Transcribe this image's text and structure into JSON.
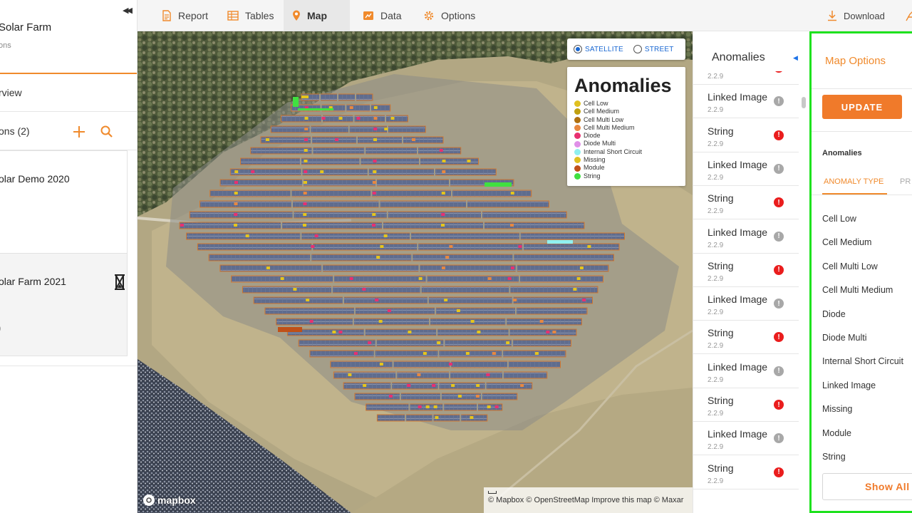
{
  "sidebar": {
    "site_title": "Solar Farm",
    "site_subtitle": "ons",
    "overview_label": "rview",
    "inspections_label": "ons (2)",
    "cards": [
      {
        "title": "olar Demo 2020",
        "meta": ""
      },
      {
        "title": "olar Farm 2021",
        "meta": ")"
      }
    ]
  },
  "toolbar": {
    "tabs": [
      {
        "label": "Report",
        "icon": "report-icon"
      },
      {
        "label": "Tables",
        "icon": "table-icon"
      },
      {
        "label": "Map",
        "icon": "map-pin-icon",
        "active": true
      },
      {
        "label": "Data",
        "icon": "data-icon"
      },
      {
        "label": "Options",
        "icon": "gear-icon"
      }
    ],
    "download_label": "Download",
    "accent": "#f08a2c"
  },
  "map": {
    "style_options": [
      "SATELLITE",
      "STREET"
    ],
    "selected_style": "SATELLITE",
    "legend_title": "Anomalies",
    "legend": [
      {
        "label": "Cell Low",
        "color": "#e0c020"
      },
      {
        "label": "Cell Medium",
        "color": "#c0a010"
      },
      {
        "label": "Cell Multi Low",
        "color": "#b07010"
      },
      {
        "label": "Cell Multi Medium",
        "color": "#e88840"
      },
      {
        "label": "Diode",
        "color": "#e83070"
      },
      {
        "label": "Diode Multi",
        "color": "#e090e8"
      },
      {
        "label": "Internal Short Circuit",
        "color": "#90f0f0"
      },
      {
        "label": "Missing",
        "color": "#e0c020"
      },
      {
        "label": "Module",
        "color": "#c05018"
      },
      {
        "label": "String",
        "color": "#40e040"
      }
    ],
    "logo_text": "mapbox",
    "attribution": "© Mapbox © OpenStreetMap Improve this map © Maxar"
  },
  "anomaly_list": {
    "title": "Anomalies",
    "items": [
      {
        "name": "",
        "version": "2.2.9",
        "kind": "err"
      },
      {
        "name": "Linked Image",
        "version": "2.2.9",
        "kind": "info"
      },
      {
        "name": "String",
        "version": "2.2.9",
        "kind": "err"
      },
      {
        "name": "Linked Image",
        "version": "2.2.9",
        "kind": "info"
      },
      {
        "name": "String",
        "version": "2.2.9",
        "kind": "err"
      },
      {
        "name": "Linked Image",
        "version": "2.2.9",
        "kind": "info"
      },
      {
        "name": "String",
        "version": "2.2.9",
        "kind": "err"
      },
      {
        "name": "Linked Image",
        "version": "2.2.9",
        "kind": "info"
      },
      {
        "name": "String",
        "version": "2.2.9",
        "kind": "err"
      },
      {
        "name": "Linked Image",
        "version": "2.2.9",
        "kind": "info"
      },
      {
        "name": "String",
        "version": "2.2.9",
        "kind": "err"
      },
      {
        "name": "Linked Image",
        "version": "2.2.9",
        "kind": "info"
      },
      {
        "name": "String",
        "version": "2.2.9",
        "kind": "err"
      }
    ]
  },
  "map_options": {
    "title": "Map Options",
    "update_label": "UPDATE",
    "section_label": "Anomalies",
    "tab_type": "ANOMALY TYPE",
    "tab_priority": "PR",
    "types": [
      "Cell Low",
      "Cell Medium",
      "Cell Multi Low",
      "Cell Multi Medium",
      "Diode",
      "Diode Multi",
      "Internal Short Circuit",
      "Linked Image",
      "Missing",
      "Module",
      "String"
    ],
    "show_all_label": "Show All"
  }
}
